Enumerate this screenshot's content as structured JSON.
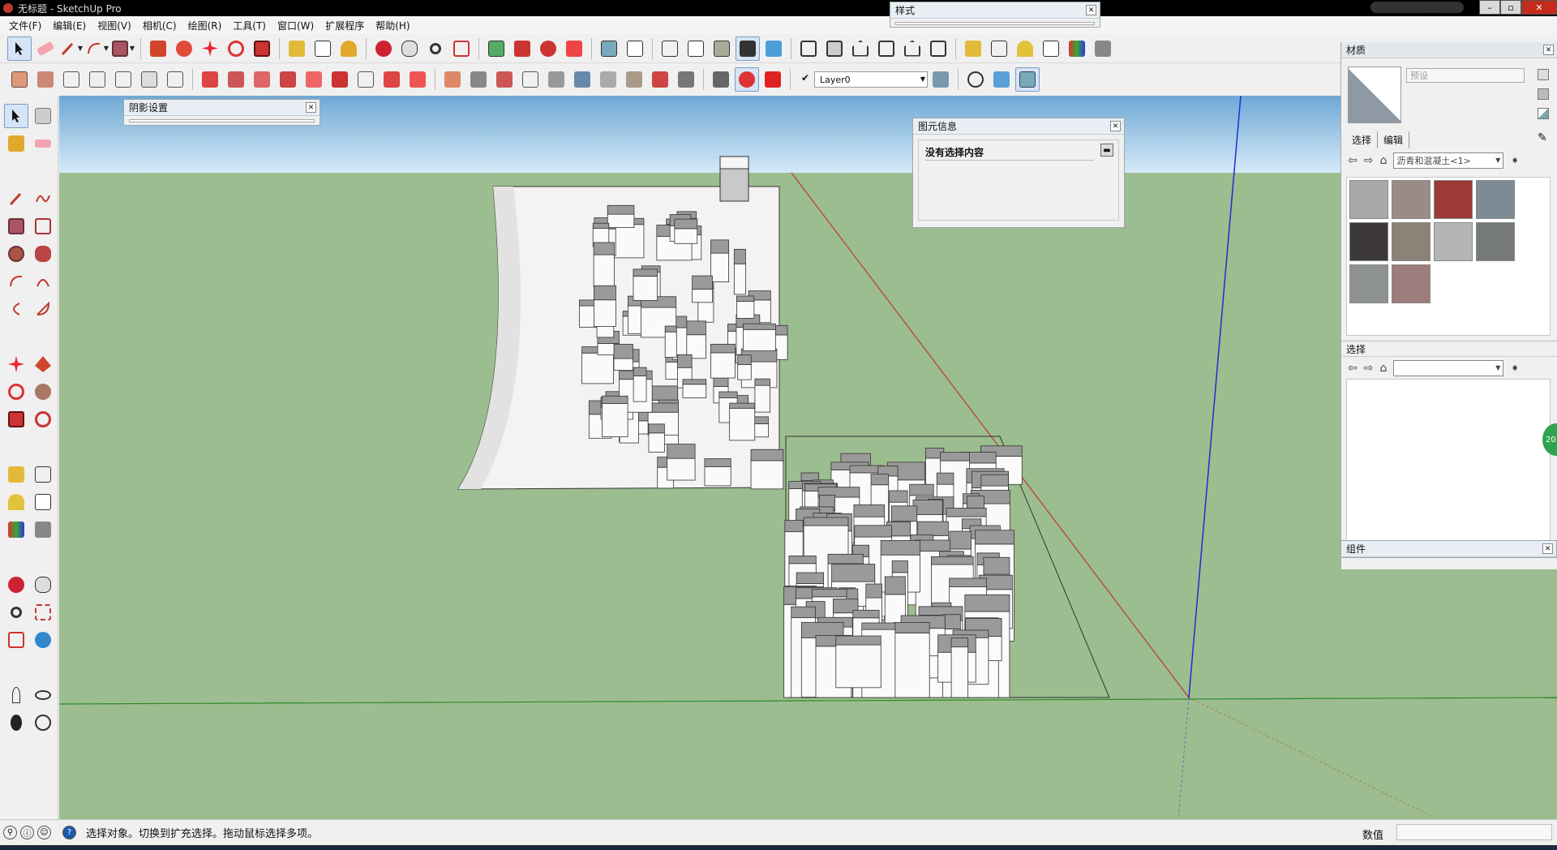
{
  "window": {
    "title": "无标题 - SketchUp Pro"
  },
  "menu": [
    "文件(F)",
    "编辑(E)",
    "视图(V)",
    "相机(C)",
    "绘图(R)",
    "工具(T)",
    "窗口(W)",
    "扩展程序",
    "帮助(H)"
  ],
  "layer": {
    "current": "Layer0"
  },
  "panels": {
    "style": {
      "title": "样式"
    },
    "shadow": {
      "title": "阴影设置"
    },
    "entity": {
      "title": "图元信息",
      "empty_text": "没有选择内容"
    }
  },
  "materials": {
    "title": "材质",
    "preset_placeholder": "预设",
    "tabs": [
      "选择",
      "编辑"
    ],
    "library": "沥青和混凝土<1>",
    "swatch_colors": [
      "#a7aaa8",
      "#9a8b86",
      "#9b3a36",
      "#7e8b95",
      "#3c3739",
      "#8d8278",
      "#b4b6b5",
      "#75797a",
      "#8f9293",
      "#9c7d7c"
    ],
    "select_title": "选择",
    "select_library": ""
  },
  "components": {
    "title": "组件"
  },
  "badge": "20",
  "status": {
    "message": "选择对象。切换到扩充选择。拖动鼠标选择多项。",
    "value_label": "数值",
    "value": ""
  }
}
